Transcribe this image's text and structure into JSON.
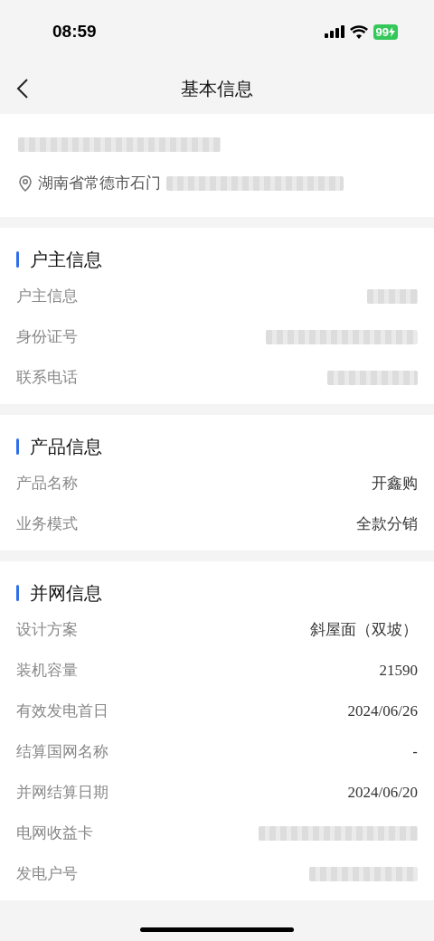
{
  "status_bar": {
    "time": "08:59",
    "battery": "99"
  },
  "header": {
    "title": "基本信息"
  },
  "summary": {
    "name_redacted": true,
    "address": "湖南省常德市石门",
    "address_redacted": true
  },
  "sections": [
    {
      "title": "户主信息",
      "rows": [
        {
          "label": "户主信息",
          "kind": "redacted"
        },
        {
          "label": "身份证号",
          "kind": "redacted"
        },
        {
          "label": "联系电话",
          "kind": "redacted"
        }
      ]
    },
    {
      "title": "产品信息",
      "rows": [
        {
          "label": "产品名称",
          "kind": "text",
          "value": "开鑫购"
        },
        {
          "label": "业务模式",
          "kind": "text",
          "value": "全款分销"
        }
      ]
    },
    {
      "title": "并网信息",
      "rows": [
        {
          "label": "设计方案",
          "kind": "text",
          "value": "斜屋面（双坡）"
        },
        {
          "label": "装机容量",
          "kind": "number",
          "value": "21590"
        },
        {
          "label": "有效发电首日",
          "kind": "number",
          "value": "2024/06/26"
        },
        {
          "label": "结算国网名称",
          "kind": "text",
          "value": "-"
        },
        {
          "label": "并网结算日期",
          "kind": "number",
          "value": "2024/06/20"
        },
        {
          "label": "电网收益卡",
          "kind": "redacted"
        },
        {
          "label": "发电户号",
          "kind": "redacted"
        }
      ]
    }
  ]
}
